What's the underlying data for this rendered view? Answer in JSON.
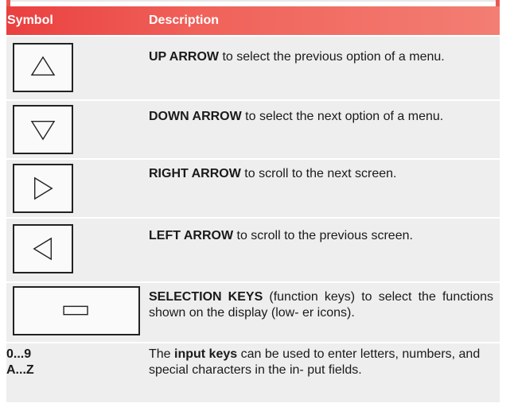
{
  "table": {
    "headers": {
      "symbol": "Symbol",
      "description": "Description"
    },
    "rows": [
      {
        "key_icon": "up-triangle-icon",
        "bold": "UP ARROW",
        "text": " to select the previous option of a menu."
      },
      {
        "key_icon": "down-triangle-icon",
        "bold": "DOWN ARROW",
        "text": " to select the next option of a menu."
      },
      {
        "key_icon": "right-triangle-icon",
        "bold": "RIGHT ARROW",
        "text": " to scroll to the next screen."
      },
      {
        "key_icon": "left-triangle-icon",
        "bold": "LEFT ARROW",
        "text": " to scroll to the previous screen."
      },
      {
        "key_icon": "rectangle-key-icon",
        "bold": "SELECTION KEYS",
        "text": " (function keys) to select the functions shown on the display (low- er icons)."
      },
      {
        "symbol_lines": [
          "0...9",
          "A...Z"
        ],
        "pre": "The ",
        "bold": "input keys",
        "text": " can be used to enter letters, numbers, and special characters in the in- put fields."
      }
    ]
  },
  "colors": {
    "header_start": "#ea4040",
    "header_end": "#f37e73",
    "row_bg": "#eeeeee"
  }
}
